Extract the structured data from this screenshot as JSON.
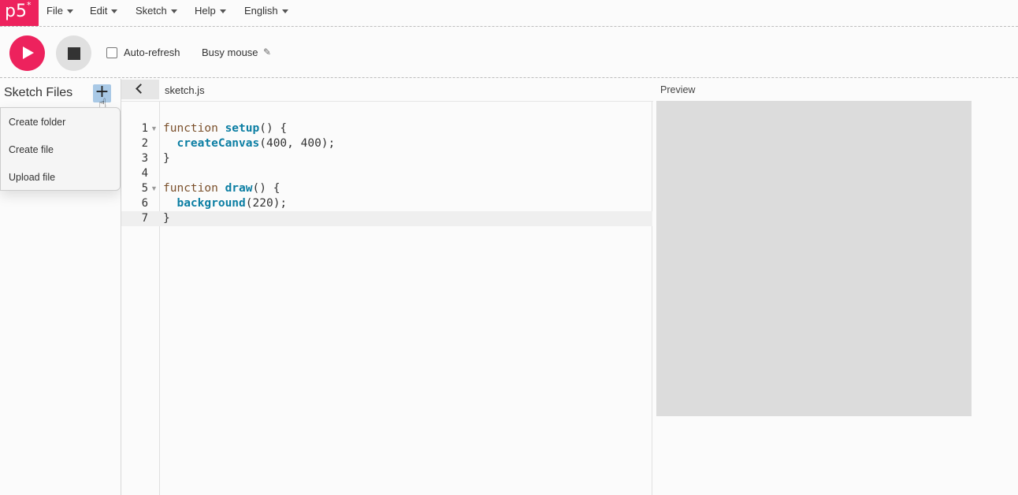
{
  "app": {
    "logo": "p5",
    "logo_mark": "*"
  },
  "menu": {
    "items": [
      {
        "label": "File"
      },
      {
        "label": "Edit"
      },
      {
        "label": "Sketch"
      },
      {
        "label": "Help"
      },
      {
        "label": "English"
      }
    ]
  },
  "toolbar": {
    "auto_refresh_label": "Auto-refresh",
    "auto_refresh_checked": false,
    "sketch_name": "Busy mouse"
  },
  "sidebar": {
    "title": "Sketch Files",
    "add_label": "+",
    "dropdown": [
      {
        "label": "Create folder"
      },
      {
        "label": "Create file"
      },
      {
        "label": "Upload file"
      }
    ]
  },
  "editor": {
    "file_name": "sketch.js",
    "active_line": 7,
    "line_numbers": [
      "1",
      "2",
      "3",
      "4",
      "5",
      "6",
      "7"
    ],
    "lines": [
      {
        "kw": "function",
        "fn": "setup",
        "rest": "() {"
      },
      {
        "kw": "",
        "fn": "createCanvas",
        "rest": "(400, 400);"
      },
      {
        "kw": "",
        "fn": "",
        "rest": "}"
      },
      {
        "kw": "",
        "fn": "",
        "rest": ""
      },
      {
        "kw": "function",
        "fn": "draw",
        "rest": "() {"
      },
      {
        "kw": "",
        "fn": "background",
        "rest": "(220);"
      },
      {
        "kw": "",
        "fn": "",
        "rest": "}"
      }
    ]
  },
  "preview": {
    "label": "Preview",
    "canvas_color": "#dcdcdc"
  },
  "colors": {
    "accent": "#ed225d",
    "hover_button": "#a9c9e6"
  }
}
